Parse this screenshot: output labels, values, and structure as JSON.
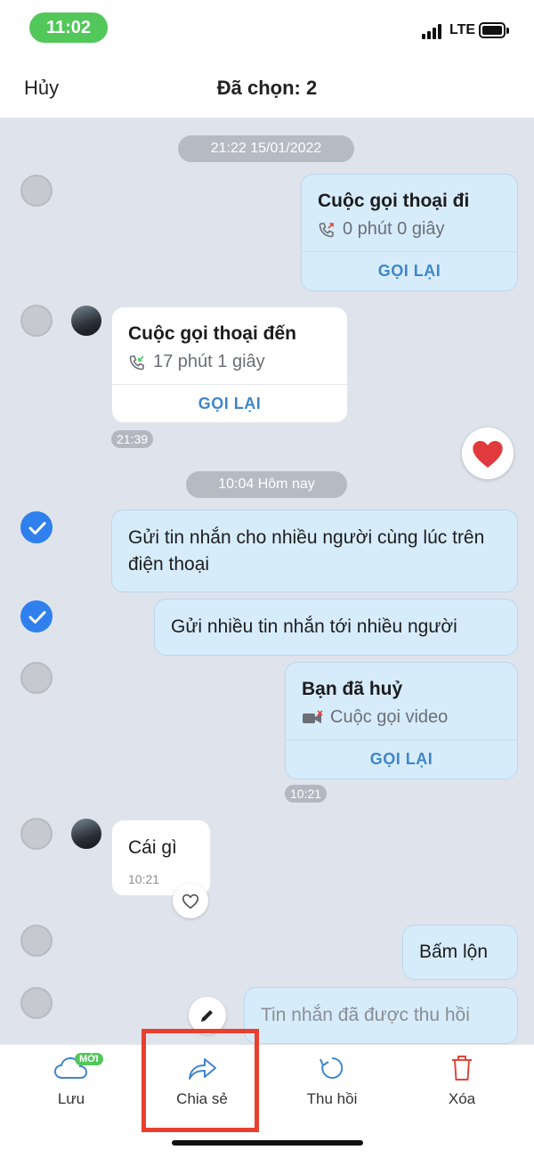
{
  "status": {
    "time": "11:02",
    "network": "LTE"
  },
  "header": {
    "cancel": "Hủy",
    "title": "Đã chọn: 2"
  },
  "chat": {
    "date_1": "21:22 15/01/2022",
    "outgoing_call": {
      "title": "Cuộc gọi thoại đi",
      "duration": "0 phút 0 giây",
      "action": "GỌI LẠI"
    },
    "incoming_call": {
      "title": "Cuộc gọi thoại đến",
      "duration": "17 phút 1 giây",
      "action": "GỌI LẠI",
      "time": "21:39"
    },
    "date_2": "10:04 Hôm nay",
    "msg_1": "Gửi tin nhắn cho nhiều người cùng lúc trên điện thoại",
    "msg_2": "Gửi nhiều tin nhắn tới nhiều người",
    "video_call": {
      "title": "Bạn đã huỷ",
      "subtitle": "Cuộc gọi video",
      "action": "GỌI LẠI",
      "time": "10:21"
    },
    "msg_3": {
      "text": "Cái gì",
      "time": "10:21"
    },
    "msg_4": "Bấm lộn",
    "msg_5": "Tin nhắn đã được thu hồi"
  },
  "bottom_bar": {
    "save": {
      "label": "Lưu",
      "badge": "MỚI"
    },
    "share": {
      "label": "Chia sẻ"
    },
    "recall": {
      "label": "Thu hồi"
    },
    "delete": {
      "label": "Xóa"
    }
  },
  "colors": {
    "accent": "#2f80ed",
    "highlight": "#e8402f",
    "delete": "#e0463b"
  }
}
